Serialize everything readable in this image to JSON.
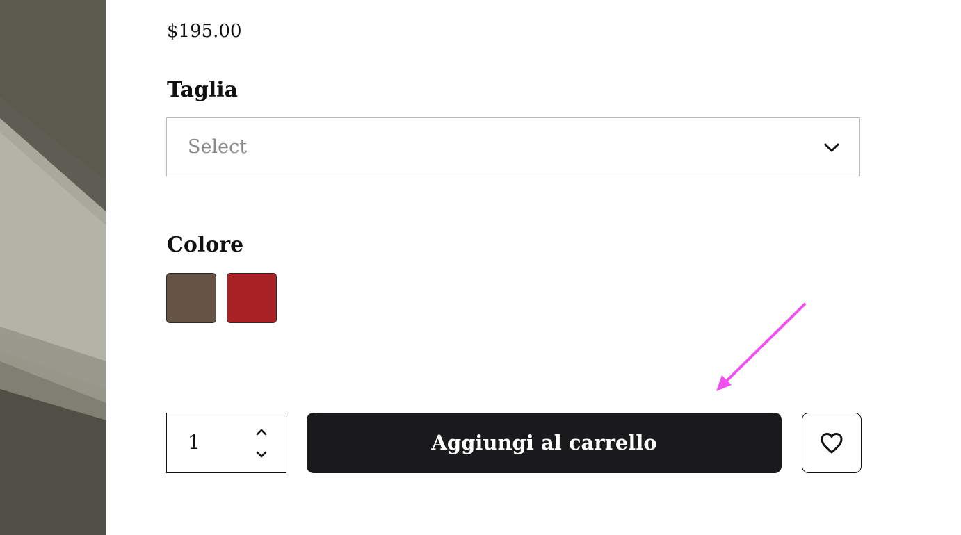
{
  "product": {
    "price": "$195.00"
  },
  "size": {
    "title": "Taglia",
    "placeholder": "Select"
  },
  "color": {
    "title": "Colore",
    "swatches": [
      {
        "color": "#655446"
      },
      {
        "color": "#a92326"
      }
    ]
  },
  "purchase": {
    "quantity": "1",
    "add_to_cart_label": "Aggiungi al carrello"
  },
  "colors": {
    "button_background": "#1a1a1c",
    "annotation_arrow": "#f050f0"
  },
  "icons": {
    "select": "chevron-down-icon",
    "quantity_up": "chevron-up-icon",
    "quantity_down": "chevron-down-icon",
    "wishlist": "heart-icon"
  }
}
